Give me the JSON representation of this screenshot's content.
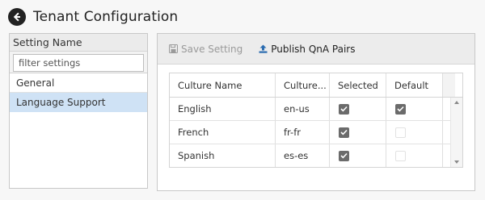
{
  "header": {
    "title": "Tenant Configuration",
    "back_icon": "back-arrow-circle-icon"
  },
  "left_panel": {
    "heading": "Setting Name",
    "filter": {
      "value": "",
      "placeholder": "filter settings"
    },
    "items": [
      {
        "label": "General",
        "selected": false
      },
      {
        "label": "Language Support",
        "selected": true
      }
    ]
  },
  "toolbar": {
    "save_label": "Save Setting",
    "save_icon": "floppy-disk-icon",
    "save_enabled": false,
    "publish_label": "Publish QnA Pairs",
    "publish_icon": "upload-icon"
  },
  "grid": {
    "columns": [
      "Culture Name",
      "Culture...",
      "Selected",
      "Default"
    ],
    "rows": [
      {
        "culture_name": "English",
        "culture_code": "en-us",
        "selected": true,
        "default": true
      },
      {
        "culture_name": "French",
        "culture_code": "fr-fr",
        "selected": true,
        "default": false
      },
      {
        "culture_name": "Spanish",
        "culture_code": "es-es",
        "selected": true,
        "default": false
      }
    ]
  },
  "colors": {
    "selected_row": "#cfe2f5",
    "checkbox_on": "#6b6b6b",
    "panel_header": "#ececec"
  }
}
